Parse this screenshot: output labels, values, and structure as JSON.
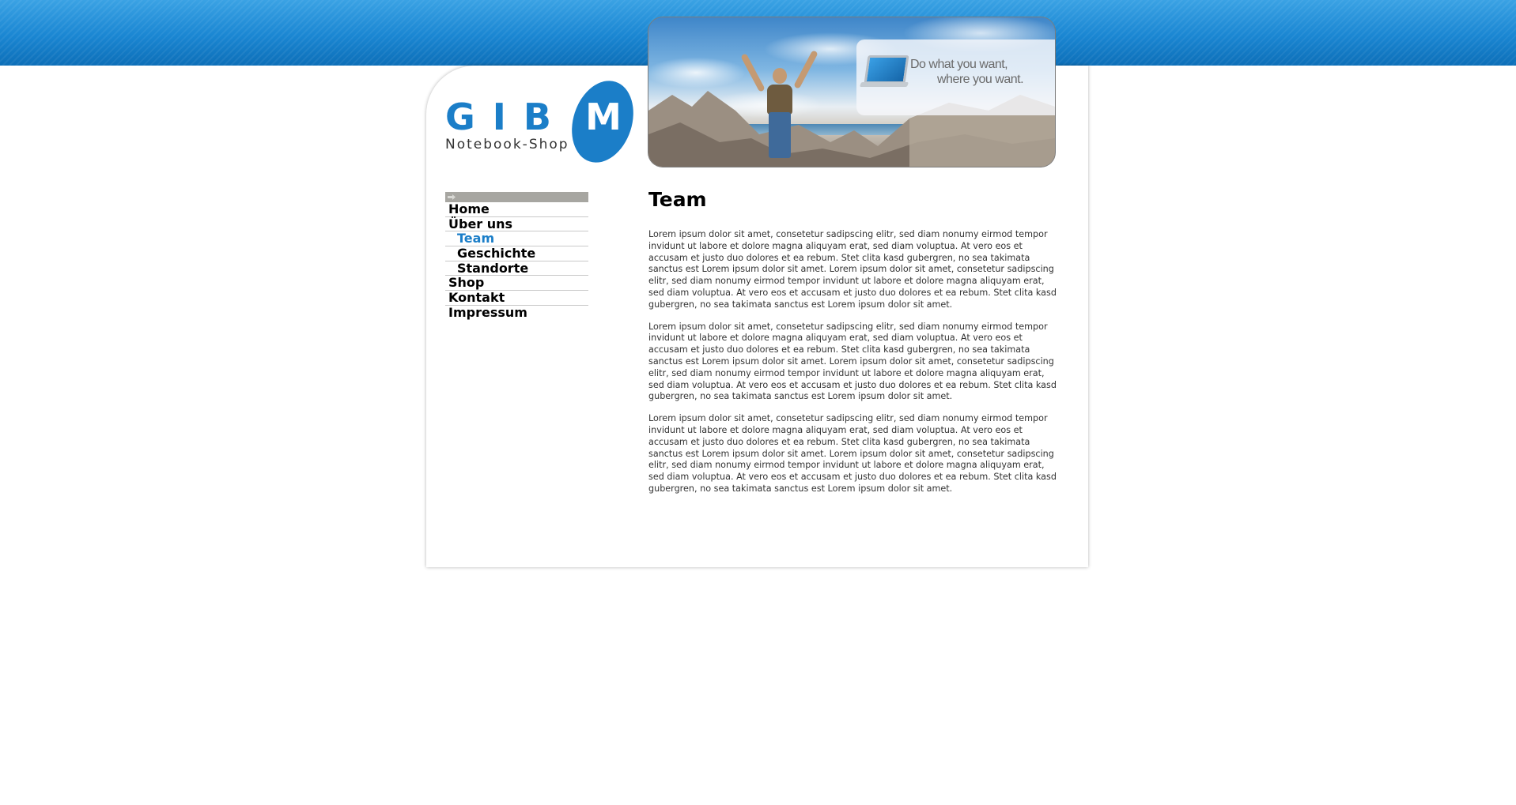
{
  "logo": {
    "letters": "GIB",
    "m": "M",
    "subtitle": "Notebook-Shop"
  },
  "banner": {
    "promo_line1": "Do what you want,",
    "promo_line2": "where you want."
  },
  "nav": {
    "items": [
      {
        "label": "Home"
      },
      {
        "label": "Über uns"
      },
      {
        "label": "Team"
      },
      {
        "label": "Geschichte"
      },
      {
        "label": "Standorte"
      },
      {
        "label": "Shop"
      },
      {
        "label": "Kontakt"
      },
      {
        "label": "Impressum"
      }
    ]
  },
  "content": {
    "title": "Team",
    "paragraphs": [
      "Lorem ipsum dolor sit amet, consetetur sadipscing elitr, sed diam nonumy eirmod tempor invidunt ut labore et dolore magna aliquyam erat, sed diam voluptua. At vero eos et accusam et justo duo dolores et ea rebum. Stet clita kasd gubergren, no sea takimata sanctus est Lorem ipsum dolor sit amet. Lorem ipsum dolor sit amet, consetetur sadipscing elitr, sed diam nonumy eirmod tempor invidunt ut labore et dolore magna aliquyam erat, sed diam voluptua. At vero eos et accusam et justo duo dolores et ea rebum. Stet clita kasd gubergren, no sea takimata sanctus est Lorem ipsum dolor sit amet.",
      "Lorem ipsum dolor sit amet, consetetur sadipscing elitr, sed diam nonumy eirmod tempor invidunt ut labore et dolore magna aliquyam erat, sed diam voluptua. At vero eos et accusam et justo duo dolores et ea rebum. Stet clita kasd gubergren, no sea takimata sanctus est Lorem ipsum dolor sit amet. Lorem ipsum dolor sit amet, consetetur sadipscing elitr, sed diam nonumy eirmod tempor invidunt ut labore et dolore magna aliquyam erat, sed diam voluptua. At vero eos et accusam et justo duo dolores et ea rebum. Stet clita kasd gubergren, no sea takimata sanctus est Lorem ipsum dolor sit amet.",
      "Lorem ipsum dolor sit amet, consetetur sadipscing elitr, sed diam nonumy eirmod tempor invidunt ut labore et dolore magna aliquyam erat, sed diam voluptua. At vero eos et accusam et justo duo dolores et ea rebum. Stet clita kasd gubergren, no sea takimata sanctus est Lorem ipsum dolor sit amet. Lorem ipsum dolor sit amet, consetetur sadipscing elitr, sed diam nonumy eirmod tempor invidunt ut labore et dolore magna aliquyam erat, sed diam voluptua. At vero eos et accusam et justo duo dolores et ea rebum. Stet clita kasd gubergren, no sea takimata sanctus est Lorem ipsum dolor sit amet."
    ]
  },
  "colors": {
    "brand_blue": "#1b7ec8",
    "nav_header_gray": "#a7a6a1",
    "active_nav": "#1b7ec8"
  },
  "icons": {
    "nav_header": "arrow-right-icon",
    "banner_product": "laptop-icon"
  }
}
